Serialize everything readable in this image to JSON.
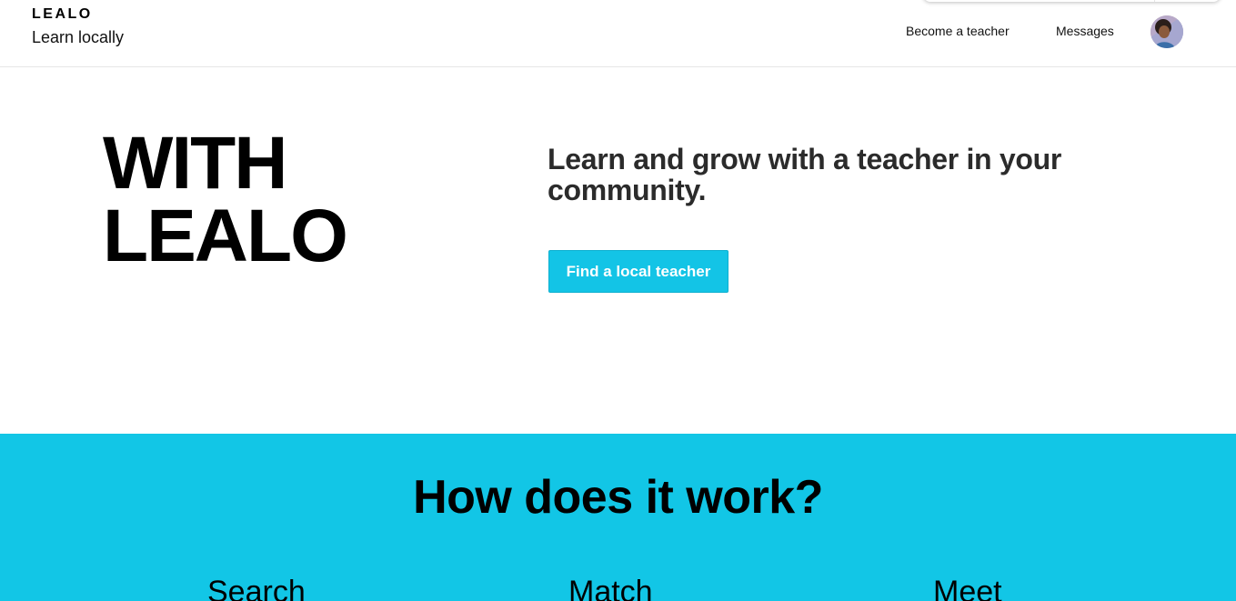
{
  "header": {
    "brand_name": "LEALO",
    "tagline": "Learn locally",
    "nav": {
      "become_teacher": "Become a teacher",
      "messages": "Messages"
    },
    "avatar_icon": "user-avatar-icon"
  },
  "hero": {
    "big_text_line1": "WITH",
    "big_text_line2": "LEALO",
    "heading": "Learn and grow with a teacher in your community.",
    "cta_label": "Find a local teacher"
  },
  "how": {
    "title": "How does it work?",
    "steps": [
      {
        "label": "Search"
      },
      {
        "label": "Match"
      },
      {
        "label": "Meet"
      }
    ]
  },
  "colors": {
    "accent": "#12c6e6",
    "text_dark": "#2b2b2b"
  }
}
